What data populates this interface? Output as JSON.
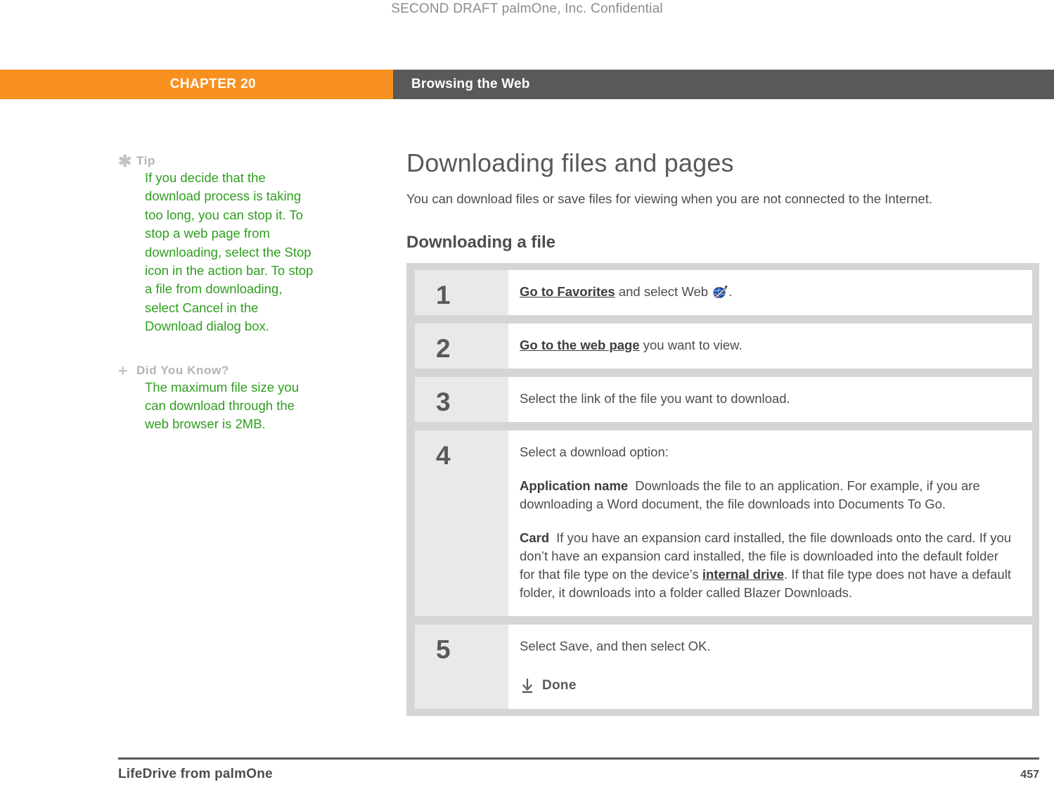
{
  "draft_header": "SECOND DRAFT palmOne, Inc.  Confidential",
  "colors": {
    "chapter_orange": "#f7901e",
    "chapter_gray": "#595959",
    "sidebar_green": "#2f9e1f",
    "sidebar_label_gray": "#b3b3b3",
    "table_frame": "#d5d5d5",
    "step_number_bg": "#e9e9e9"
  },
  "chapter_bar": {
    "chapter_label": "CHAPTER 20",
    "section_label": "Browsing the Web"
  },
  "sidebar": {
    "blocks": [
      {
        "icon": "asterisk-icon",
        "title": "Tip",
        "body": "If you decide that the download process is taking too long, you can stop it. To stop a web page from downloading, select the Stop icon in the action bar. To stop a file from downloading, select Cancel in the Download dialog box."
      },
      {
        "icon": "plus-icon",
        "title": "Did You Know?",
        "body": "The maximum file size you can download through the web browser is 2MB."
      }
    ]
  },
  "main": {
    "heading": "Downloading files and pages",
    "intro": "You can download files or save files for viewing when you are not connected to the Internet.",
    "subheading": "Downloading a file",
    "steps": [
      {
        "number": "1",
        "link_text": "Go to Favorites",
        "text_after_link": " and select Web ",
        "icon": "web-globe-icon",
        "text_tail": "."
      },
      {
        "number": "2",
        "link_text": "Go to the web page",
        "text_after_link": " you want to view."
      },
      {
        "number": "3",
        "text": "Select the link of the file you want to download."
      },
      {
        "number": "4",
        "text": "Select a download option:",
        "options": [
          {
            "term": "Application name",
            "description": "Downloads the file to an application. For example, if you are downloading a Word document, the file downloads into Documents To Go."
          },
          {
            "term": "Card",
            "description_part1": "If you have an expansion card installed, the file downloads onto the card. If you don’t have an expansion card installed, the file is downloaded into the default folder for that file type on the device’s ",
            "link_text": "internal drive",
            "description_part2": ". If that file type does not have a default folder, it downloads into a folder called Blazer Downloads."
          }
        ]
      },
      {
        "number": "5",
        "text": "Select Save, and then select OK.",
        "done_icon": "download-arrow-icon",
        "done_label": "Done"
      }
    ]
  },
  "footer": {
    "title": "LifeDrive from palmOne",
    "page_number": "457"
  }
}
